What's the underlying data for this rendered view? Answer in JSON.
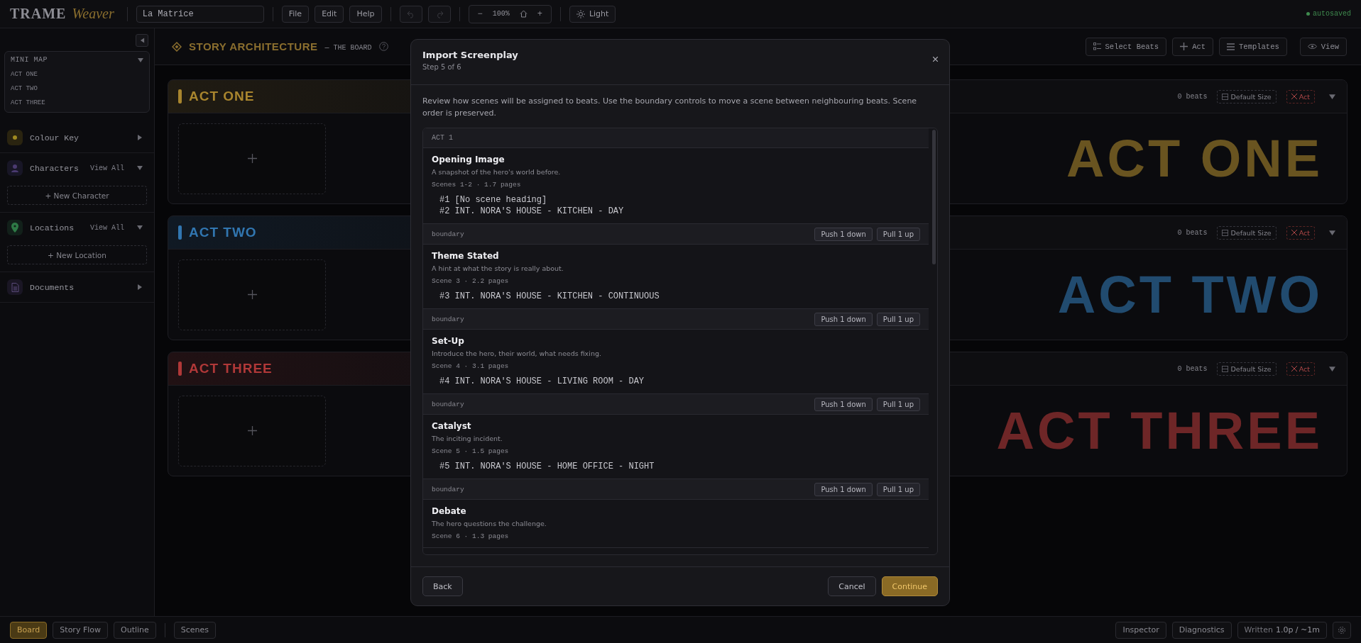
{
  "topbar": {
    "logo_main": "TRAME",
    "logo_sub": "Weaver",
    "project_name": "La Matrice",
    "menus": [
      "File",
      "Edit",
      "Help"
    ],
    "history": [
      {
        "kind": "undo",
        "disabled": true
      },
      {
        "kind": "redo",
        "disabled": true
      }
    ],
    "zoom": {
      "minus": "−",
      "value": "100%",
      "plus": "+"
    },
    "theme_button": "Light",
    "autosave": "autosaved"
  },
  "sidebar": {
    "minimap": {
      "title": "MINI MAP",
      "expanded": true,
      "items": [
        "ACT ONE",
        "ACT TWO",
        "ACT THREE"
      ]
    },
    "sections": [
      {
        "label": "Colour Key",
        "expanded": false
      },
      {
        "label": "Characters",
        "action": "View All",
        "expanded": true,
        "add_button": "+ New Character"
      },
      {
        "label": "Locations",
        "action": "View All",
        "expanded": true,
        "add_button": "+ New Location"
      },
      {
        "label": "Documents",
        "expanded": false
      }
    ]
  },
  "board": {
    "title": "STORY ARCHITECTURE",
    "subtitle": "— THE BOARD",
    "toolbar": [
      {
        "kind": "select",
        "label": "Select Beats"
      },
      {
        "kind": "add",
        "label": "Act"
      },
      {
        "kind": "list",
        "label": "Templates"
      },
      {
        "kind": "view",
        "label": "View"
      }
    ],
    "acts": [
      {
        "name": "ACT ONE",
        "color": "#a8852e",
        "beats": "0 beats",
        "size_button": "Default Size",
        "delete_button": "Act",
        "backdrop": "ACT ONE",
        "expanded": true
      },
      {
        "name": "ACT TWO",
        "color": "#3176b0",
        "beats": "0 beats",
        "size_button": "Default Size",
        "delete_button": "Act",
        "backdrop": "ACT TWO",
        "expanded": true
      },
      {
        "name": "ACT THREE",
        "color": "#b03838",
        "beats": "0 beats",
        "size_button": "Default Size",
        "delete_button": "Act",
        "backdrop": "ACT THREE",
        "expanded": true
      }
    ]
  },
  "bottombar": {
    "tabs": [
      {
        "label": "Board",
        "selected": true
      },
      {
        "label": "Story Flow",
        "selected": false
      },
      {
        "label": "Outline",
        "selected": false
      }
    ],
    "scenes_button": "Scenes",
    "right": [
      "Inspector",
      "Diagnostics"
    ],
    "written_label": "Written",
    "written_value": "1.0p / ~1m"
  },
  "dialog": {
    "title": "Import Screenplay",
    "step": "Step 5 of 6",
    "description": "Review how scenes will be assigned to beats. Use the boundary controls to move a scene between neighbouring beats. Scene order is preserved.",
    "act_label": "ACT 1",
    "beats": [
      {
        "title": "Opening Image",
        "description": "A snapshot of the hero's world before.",
        "summary": "Scenes 1-2 · 1.7 pages",
        "scenes": [
          "#1 [No scene heading]",
          "#2 INT. NORA'S HOUSE - KITCHEN - DAY"
        ]
      },
      {
        "title": "Theme Stated",
        "description": "A hint at what the story is really about.",
        "summary": "Scene 3 · 2.2 pages",
        "scenes": [
          "#3 INT. NORA'S HOUSE - KITCHEN - CONTINUOUS"
        ]
      },
      {
        "title": "Set-Up",
        "description": "Introduce the hero, their world, what needs fixing.",
        "summary": "Scene 4 · 3.1 pages",
        "scenes": [
          "#4 INT. NORA'S HOUSE - LIVING ROOM - DAY"
        ]
      },
      {
        "title": "Catalyst",
        "description": "The inciting incident.",
        "summary": "Scene 5 · 1.5 pages",
        "scenes": [
          "#5 INT. NORA'S HOUSE - HOME OFFICE - NIGHT"
        ]
      },
      {
        "title": "Debate",
        "description": "The hero questions the challenge.",
        "summary": "Scene 6 · 1.3 pages"
      }
    ],
    "boundaries": [
      {
        "label": "boundary",
        "push_button": "Push 1 down",
        "pull_button": "Pull 1 up"
      },
      {
        "label": "boundary",
        "push_button": "Push 1 down",
        "pull_button": "Pull 1 up"
      },
      {
        "label": "boundary",
        "push_button": "Push 1 down",
        "pull_button": "Pull 1 up"
      },
      {
        "label": "boundary",
        "push_button": "Push 1 down",
        "pull_button": "Pull 1 up"
      }
    ],
    "back": "Back",
    "cancel": "Cancel",
    "continue": "Continue"
  }
}
